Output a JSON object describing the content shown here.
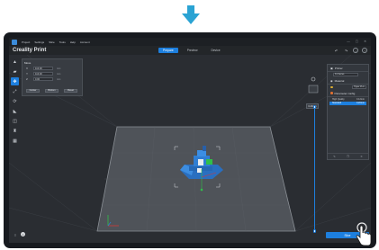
{
  "menu": {
    "items": [
      "Project",
      "Settings",
      "Slice",
      "Tools",
      "Help",
      "Account"
    ]
  },
  "window_controls": [
    "—",
    "▢",
    "✕"
  ],
  "header": {
    "app_name": "Creality Print",
    "tabs": [
      {
        "label": "Prepare",
        "active": true
      },
      {
        "label": "Preview",
        "active": false
      },
      {
        "label": "Device",
        "active": false
      }
    ],
    "icons": [
      "undo-icon",
      "redo-icon",
      "download-icon",
      "upload-icon"
    ]
  },
  "left_toolbar": {
    "tools": [
      {
        "name": "open-file-icon",
        "glyph": "▲",
        "active": false
      },
      {
        "name": "add-file-icon",
        "glyph": "▰",
        "active": false
      },
      {
        "name": "move-icon",
        "glyph": "✥",
        "active": true
      },
      {
        "name": "scale-icon",
        "glyph": "⤢",
        "active": false
      },
      {
        "name": "rotate-icon",
        "glyph": "⟳",
        "active": false
      },
      {
        "name": "lay-flat-icon",
        "glyph": "◣",
        "active": false
      },
      {
        "name": "mirror-icon",
        "glyph": "◫",
        "active": false
      },
      {
        "name": "support-icon",
        "glyph": "♜",
        "active": false
      },
      {
        "name": "arrange-icon",
        "glyph": "▦",
        "active": false
      }
    ]
  },
  "transform_panel": {
    "title": "Move",
    "rows": [
      {
        "axis": "X",
        "value": "110.00",
        "unit": "mm"
      },
      {
        "axis": "Y",
        "value": "110.00",
        "unit": "mm"
      },
      {
        "axis": "Z",
        "value": "0.00",
        "unit": "mm"
      }
    ],
    "buttons": [
      "Center",
      "Bottom",
      "Reset"
    ]
  },
  "right_panel": {
    "printer_label": "Printer",
    "printer_value": "K1 Series",
    "material_label": "Material",
    "material_value": "Hyper PLA",
    "params_label": "Parameter config",
    "profiles": [
      {
        "name": "High Quality",
        "value": "0.12mm",
        "selected": false
      },
      {
        "name": "Standard",
        "value": "0.20mm",
        "selected": true
      }
    ],
    "colors": {
      "material_dot": "#e0b030",
      "params_dot": "#e07030"
    }
  },
  "layer_slider": {
    "top_label": "0.20mm"
  },
  "view_cube": {
    "label": "Top"
  },
  "slice_button": {
    "label": "Slice"
  },
  "colors": {
    "accent": "#1d7fde",
    "model": "#2f7ed3",
    "bed": "#55595f"
  }
}
